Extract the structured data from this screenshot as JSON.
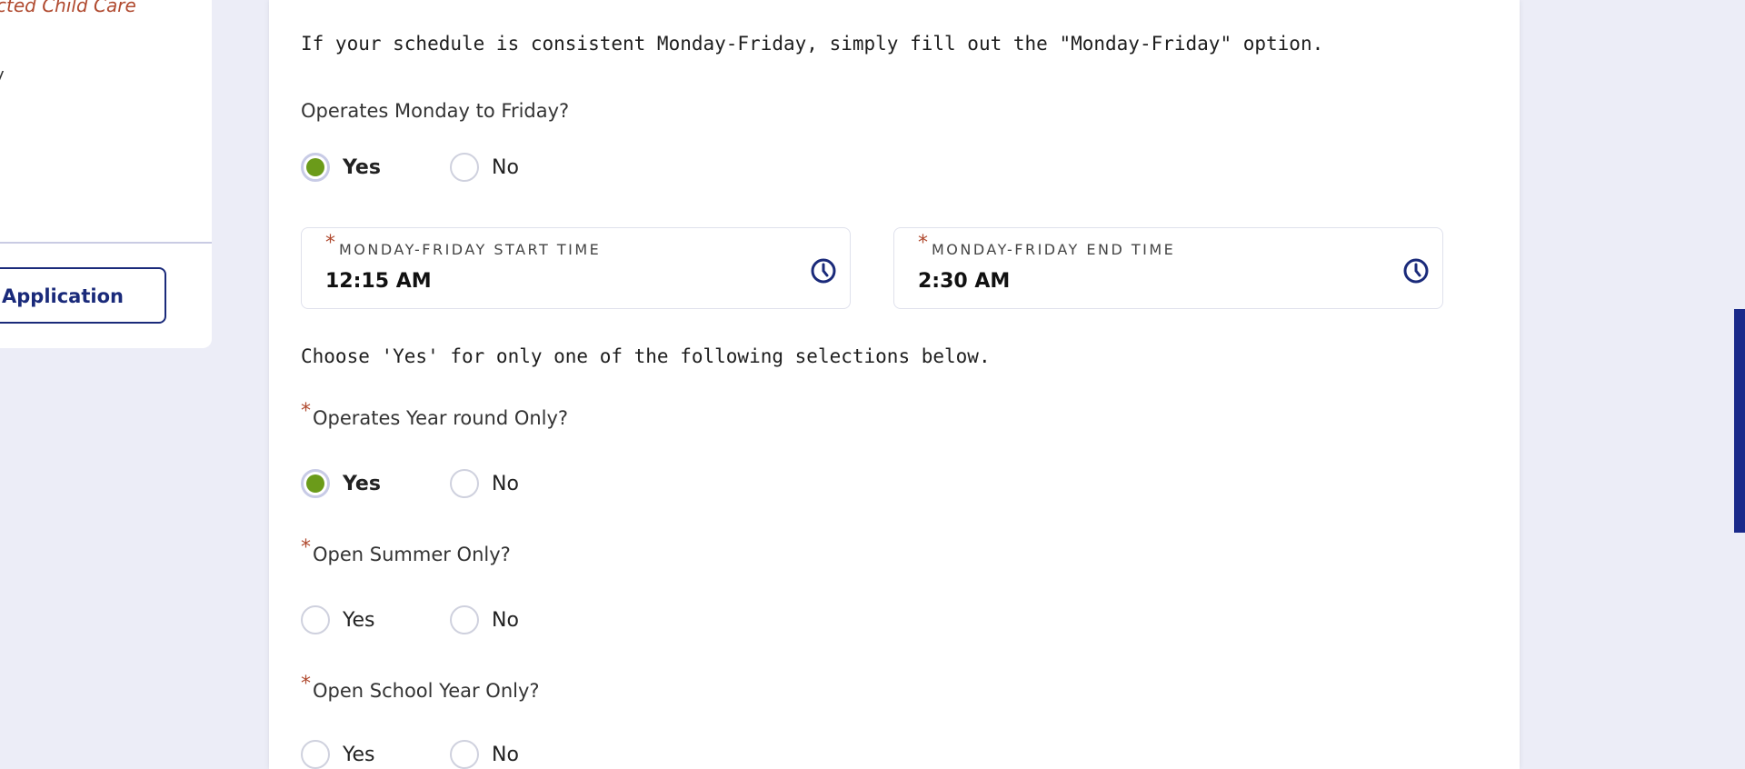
{
  "sidebar": {
    "link_fragment": "cted Child Care",
    "small_fragment": "y",
    "application_button": "Application"
  },
  "form": {
    "instruction": "If your schedule is consistent Monday-Friday, simply fill out the \"Monday-Friday\" option.",
    "mon_fri_question": "Operates Monday to Friday?",
    "mon_fri_selected": "Yes",
    "start_time": {
      "label": "MONDAY-FRIDAY START TIME",
      "value": "12:15 AM"
    },
    "end_time": {
      "label": "MONDAY-FRIDAY END TIME",
      "value": "2:30 AM"
    },
    "choose_instruction": "Choose 'Yes' for only one of the following selections below.",
    "year_round_question": "Operates Year round Only?",
    "year_round_selected": "Yes",
    "summer_question": "Open Summer Only?",
    "school_year_question": "Open School Year Only?",
    "options": {
      "yes": "Yes",
      "no": "No"
    },
    "required_marker": "*"
  },
  "colors": {
    "accent_navy": "#1a2a7a",
    "radio_selected": "#6b9b1a",
    "required_red": "#b04a2f",
    "page_bg": "#ecedf7"
  },
  "icons": {
    "time_picker": "clock-icon"
  }
}
